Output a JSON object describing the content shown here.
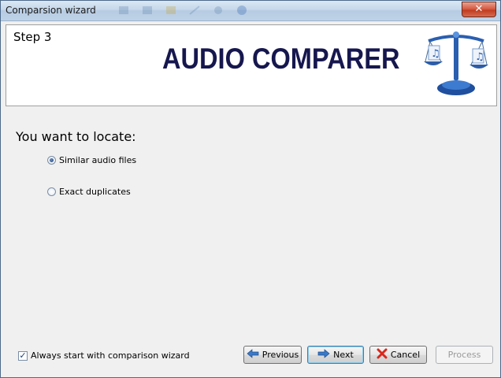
{
  "window": {
    "title": "Comparsion wizard",
    "close_label": "✕"
  },
  "header": {
    "step": "Step 3",
    "brand": "AUDIO COMPARER"
  },
  "main": {
    "question": "You want to locate:",
    "options": [
      {
        "label": "Similar audio files",
        "selected": true
      },
      {
        "label": "Exact duplicates",
        "selected": false
      }
    ]
  },
  "footer": {
    "always_start_label": "Always start with comparison wizard",
    "always_start_checked": true,
    "buttons": {
      "previous": "Previous",
      "next": "Next",
      "cancel": "Cancel",
      "process": "Process"
    }
  },
  "icons": {
    "previous": "arrow-left-icon",
    "next": "arrow-right-icon",
    "cancel": "red-x-icon",
    "logo": "scales-with-music-notes-icon"
  }
}
